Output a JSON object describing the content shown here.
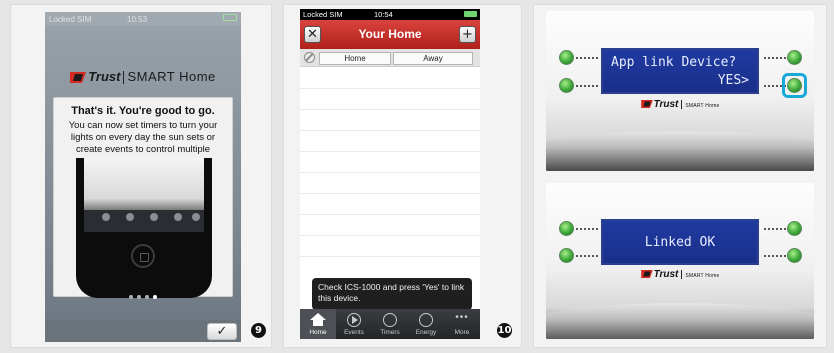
{
  "steps": {
    "step1": "9",
    "step2": "10"
  },
  "screen1": {
    "status_carrier": "Locked SIM",
    "status_time": "10:53",
    "brand_name": "Trust",
    "brand_product": "SMART Home",
    "card_title": "That's it. You're good to go.",
    "card_body": "You can now set timers to turn your lights on every day the sun sets or create events to control multiple",
    "confirm_label": "✓"
  },
  "screen2": {
    "status_carrier": "Locked SIM",
    "status_time": "10:54",
    "nav_title": "Your Home",
    "settings_icon": "✕",
    "add_icon": "+",
    "segments": [
      "Home",
      "Away"
    ],
    "toast": "Check ICS-1000 and press 'Yes' to link this device.",
    "tabs": [
      "Home",
      "Events",
      "Timers",
      "Energy",
      "More"
    ],
    "more_icon": "•••"
  },
  "device1": {
    "lcd_line1": "App link Device?",
    "lcd_line2": "YES>",
    "brand_name": "Trust",
    "brand_product": "SMART Home"
  },
  "device2": {
    "lcd_line1": "Linked OK",
    "brand_name": "Trust",
    "brand_product": "SMART Home"
  },
  "colors": {
    "app_header_red": "#c42e28",
    "lcd_blue": "#1f3aa0",
    "led_green": "#3ea83a",
    "highlight_cyan": "#19a9d9"
  }
}
